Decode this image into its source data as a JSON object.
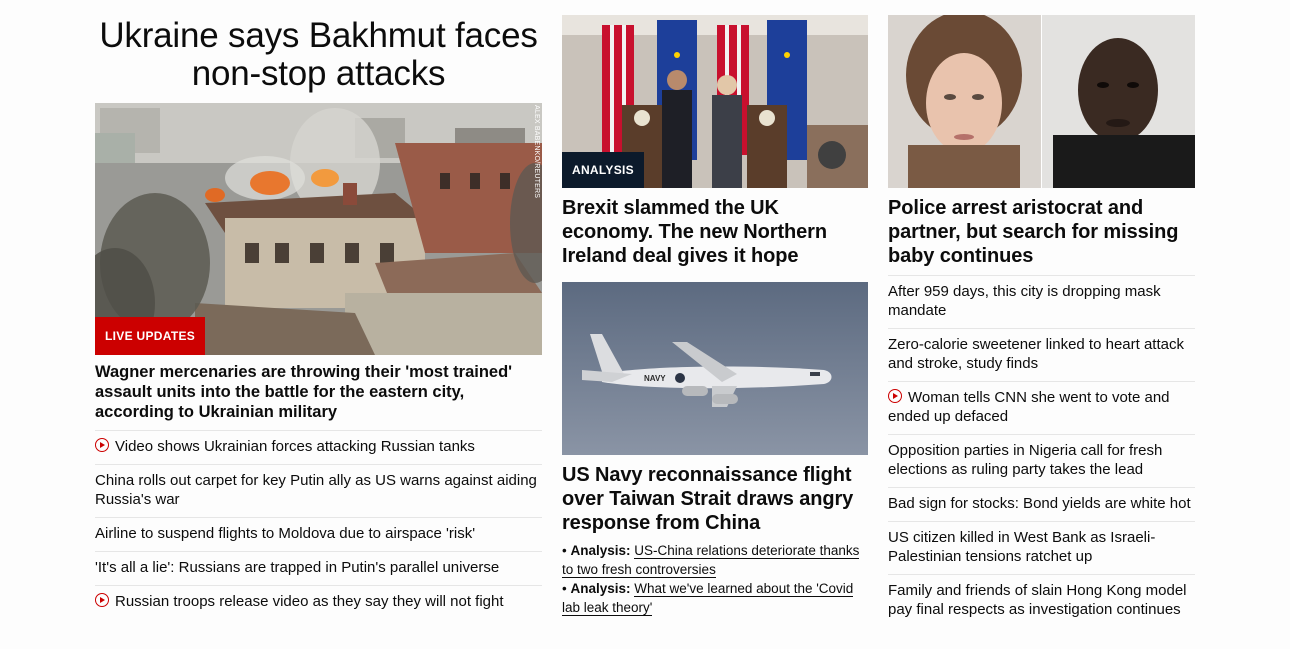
{
  "col1": {
    "headline": "Ukraine says Bakhmut faces non-stop attacks",
    "photo_credit": "ALEX BABENKO/REUTERS",
    "badge": "LIVE UPDATES",
    "lead": "Wagner mercenaries are throwing their 'most trained' assault units into the battle for the eastern city, according to Ukrainian military",
    "items": [
      {
        "text": "Video shows Ukrainian forces attacking Russian tanks",
        "video": true
      },
      {
        "text": "China rolls out carpet for key Putin ally as US warns against aiding Russia's war",
        "video": false
      },
      {
        "text": "Airline to suspend flights to Moldova due to airspace 'risk'",
        "video": false
      },
      {
        "text": "'It's all a lie': Russians are trapped in Putin's parallel universe",
        "video": false
      },
      {
        "text": "Russian troops release video as they say they will not fight",
        "video": true
      }
    ]
  },
  "col2": {
    "card1": {
      "badge": "ANALYSIS",
      "headline": "Brexit slammed the UK economy. The new Northern Ireland deal gives it hope"
    },
    "card2": {
      "headline": "US Navy reconnaissance flight over Taiwan Strait draws angry response from China",
      "plane_marking": "NAVY",
      "bullets": [
        {
          "label": "Analysis:",
          "text": "US-China relations deteriorate thanks to two fresh controversies"
        },
        {
          "label": "Analysis:",
          "text": "What we've learned about the 'Covid lab leak theory'"
        }
      ]
    }
  },
  "col3": {
    "headline": "Police arrest aristocrat and partner, but search for missing baby continues",
    "items": [
      {
        "text": "After 959 days, this city is dropping mask mandate",
        "video": false
      },
      {
        "text": "Zero-calorie sweetener linked to heart attack and stroke, study finds",
        "video": false
      },
      {
        "text": "Woman tells CNN she went to vote and ended up defaced",
        "video": true
      },
      {
        "text": "Opposition parties in Nigeria call for fresh elections as ruling party takes the lead",
        "video": false
      },
      {
        "text": "Bad sign for stocks: Bond yields are white hot",
        "video": false
      },
      {
        "text": "US citizen killed in West Bank as Israeli-Palestinian tensions ratchet up",
        "video": false
      },
      {
        "text": "Family and friends of slain Hong Kong model pay final respects as investigation continues",
        "video": false
      }
    ]
  },
  "colors": {
    "live_badge": "#cc0000",
    "analysis_badge": "#0c1a2b",
    "text": "#0c0c0c",
    "divider": "#e6e6e6"
  }
}
